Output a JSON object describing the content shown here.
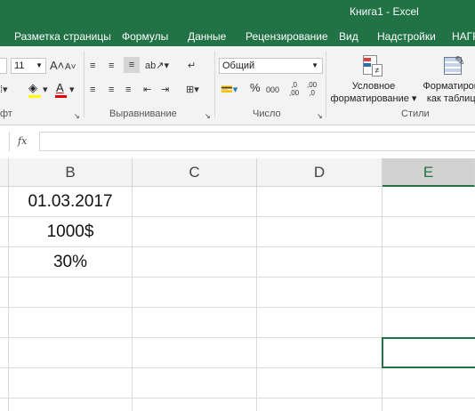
{
  "window": {
    "title": "Книга1  -  Excel"
  },
  "ribbon_tabs": [
    "Разметка страницы",
    "Формулы",
    "Данные",
    "Рецензирование",
    "Вид",
    "Надстройки",
    "НАГР"
  ],
  "font_group": {
    "size": "11",
    "label": "фт"
  },
  "alignment_group": {
    "label": "Выравнивание"
  },
  "number_group": {
    "format": "Общий",
    "label": "Число",
    "percent": "%",
    "thousands": "000",
    "inc_dec": ",0\n,00",
    "dec_dec": ",00\n,0"
  },
  "styles_group": {
    "label": "Стили",
    "conditional": [
      "Условное",
      "форматирование ▾"
    ],
    "as_table": [
      "Форматирова",
      "как таблицу"
    ]
  },
  "formula_bar": {
    "fx": "fx",
    "value": ""
  },
  "sheet": {
    "columns": [
      "B",
      "C",
      "D",
      "E"
    ],
    "cells": {
      "B1": "01.03.2017",
      "B2": "1000$",
      "B3": "30%"
    }
  },
  "colors": {
    "accent": "#217346",
    "ribbon_bg": "#f3f3f3",
    "grid": "#dadada"
  }
}
